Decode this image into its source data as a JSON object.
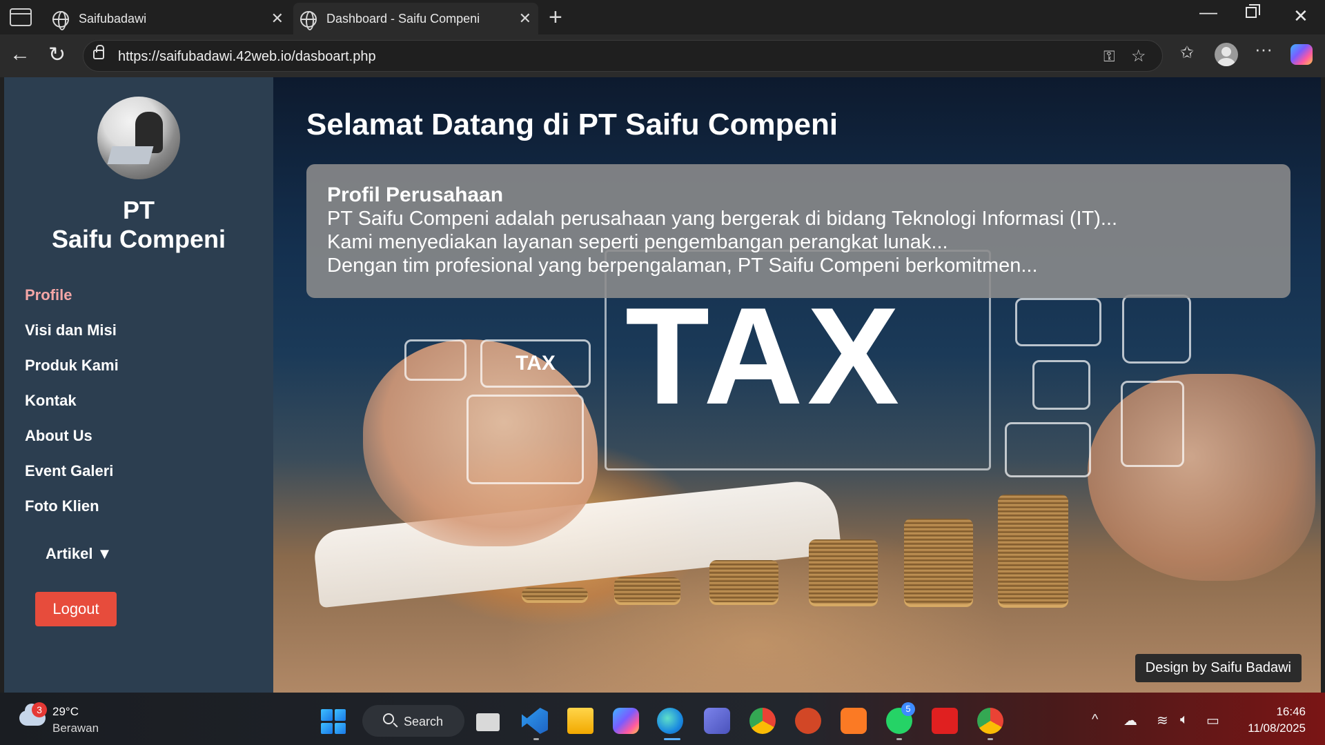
{
  "browser": {
    "tabs": [
      {
        "title": "Saifubadawi"
      },
      {
        "title": "Dashboard - Saifu Compeni"
      }
    ],
    "url": "https://saifubadawi.42web.io/dasboart.php"
  },
  "sidebar": {
    "brand_line1": "PT",
    "brand_line2": "Saifu Compeni",
    "menu": [
      {
        "label": "Profile"
      },
      {
        "label": "Visi dan Misi"
      },
      {
        "label": "Produk Kami"
      },
      {
        "label": "Kontak"
      },
      {
        "label": "About Us"
      },
      {
        "label": "Event Galeri"
      },
      {
        "label": "Foto Klien"
      }
    ],
    "artikel_label": "Artikel ▼",
    "logout_label": "Logout"
  },
  "main": {
    "title": "Selamat Datang di PT Saifu Compeni",
    "profile_heading": "Profil Perusahaan",
    "profile_lines": [
      "PT Saifu Compeni adalah perusahaan yang bergerak di bidang Teknologi Informasi (IT)...",
      "Kami menyediakan layanan seperti pengembangan perangkat lunak...",
      "Dengan tim profesional yang berpengalaman, PT Saifu Compeni berkomitmen..."
    ],
    "hero_text": "TAX",
    "hero_small_tax": "TAX",
    "footer": "Design by Saifu Badawi"
  },
  "taskbar": {
    "weather_badge": "3",
    "temperature": "29°C",
    "condition": "Berawan",
    "search_label": "Search",
    "whatsapp_badge": "5",
    "time": "16:46",
    "date": "11/08/2025"
  },
  "colors": {
    "sidebar_bg": "#2c3e50",
    "active_menu": "#f4a6a6",
    "logout_bg": "#e74c3c"
  }
}
